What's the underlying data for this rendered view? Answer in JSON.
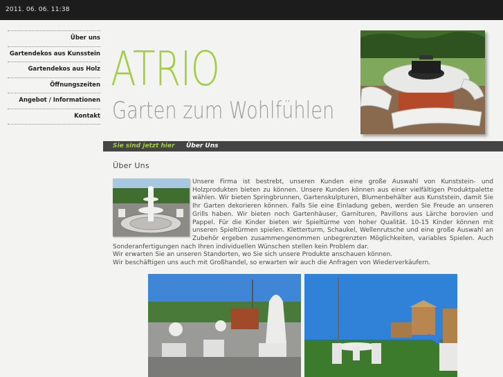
{
  "topbar": {
    "datetime": "2011. 06. 06. 11:38"
  },
  "nav": {
    "items": [
      {
        "label": "Über uns"
      },
      {
        "label": "Gartendekos aus Kunsstein"
      },
      {
        "label": "Gartendekos aus Holz"
      },
      {
        "label": "Öffnungszeiten"
      },
      {
        "label": "Angebot / Informationen"
      },
      {
        "label": "Kontakt"
      }
    ]
  },
  "logo": {
    "name": "ATRIO",
    "tagline": "Garten zum Wohlfühlen"
  },
  "breadcrumb": {
    "prefix": "Sie sind jetzt hier",
    "current": "Über Uns"
  },
  "page": {
    "title": "Über Uns",
    "paragraph1": "Unsere Firma ist bestrebt, unseren Kunden eine große Auswahl von Kunststein- und Holzprodukten bieten zu können. Unsere Kunden können aus einer vielfältigen Produktpalette wählen. Wir bieten Springbrunnen, Gartenskulpturen, Blumenbehälter aus Kunststein, damit Sie Ihr Garten dekorieren können. Falls Sie eine Einladung geben, werden Sie Freude an unseren Grills haben. Wir bieten noch Gartenhäuser, Garnituren, Pavillons aus Lärche borovien und Pappel. Für die Kinder bieten wir Spieltürme von hoher Qualität. 10-15 Kinder können mit unseren Spieltürmen spielen. Kletterturm, Schaukel, Wellenrutsche und eine große Auswahl an Zubehör ergeben zusammengenommen unbegrenzten Möglichkeiten, variables Spielen. Auch Sonderanfertigungen nach Ihren individuellen Wünschen stellen kein Problem dar.",
    "paragraph2": "Wir erwarten Sie an unseren Standorten, wo Sie sich unsere Produkte anschauen können.",
    "paragraph3": "Wir beschäftigen uns auch mit Großhandel, so erwarten wir auch die Anfragen von Wiederverkäufern."
  },
  "colors": {
    "accent": "#a3cd49",
    "topbar": "#1c1c1c",
    "breadcrumb": "#444444"
  }
}
